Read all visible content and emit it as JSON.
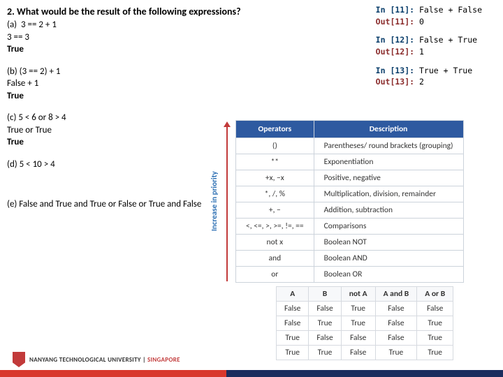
{
  "title": "2. What would be the result of the following expressions?",
  "qa": {
    "a_label": "(a)  3 == 2 + 1",
    "a_line2": "3 == 3",
    "a_ans": "True",
    "b_label": "(b) (3 == 2) + 1",
    "b_line2": "False + 1",
    "b_ans": "True",
    "c_label": "(c) 5 < 6 or 8 > 4",
    "c_line2": "True or True",
    "c_ans": "True",
    "d_label": "(d) 5 < 10 > 4",
    "e_label": "(e) False and True and True or False or True and False"
  },
  "code": {
    "in11": "In [11]:",
    "in11v": " False + False",
    "out11": "Out[11]:",
    "out11v": " 0",
    "in12": "In [12]:",
    "in12v": " False + True",
    "out12": "Out[12]:",
    "out12v": " 1",
    "in13": "In [13]:",
    "in13v": " True + True",
    "out13": "Out[13]:",
    "out13v": " 2"
  },
  "op_table": {
    "h1": "Operators",
    "h2": "Description",
    "rows": [
      {
        "op": "()",
        "desc": "Parentheses/ round brackets (grouping)"
      },
      {
        "op": "**",
        "desc": "Exponentiation"
      },
      {
        "op": "+x, −x",
        "desc": "Positive, negative"
      },
      {
        "op": "*, /, %",
        "desc": "Multiplication, division, remainder"
      },
      {
        "op": "+, −",
        "desc": "Addition, subtraction"
      },
      {
        "op": "<, <=, >, >=, !=, ==",
        "desc": "Comparisons"
      },
      {
        "op": "not x",
        "desc": "Boolean NOT"
      },
      {
        "op": "and",
        "desc": "Boolean AND"
      },
      {
        "op": "or",
        "desc": "Boolean OR"
      }
    ],
    "priority_label": "Increase in priority"
  },
  "truth": {
    "head": {
      "a": "A",
      "b": "B",
      "not": "not A",
      "and": "A and B",
      "or": "A or B"
    },
    "rows": [
      {
        "a": "False",
        "b": "False",
        "not": "True",
        "and": "False",
        "or": "False"
      },
      {
        "a": "False",
        "b": "True",
        "not": "True",
        "and": "False",
        "or": "True"
      },
      {
        "a": "True",
        "b": "False",
        "not": "False",
        "and": "False",
        "or": "True"
      },
      {
        "a": "True",
        "b": "True",
        "not": "False",
        "and": "True",
        "or": "True"
      }
    ]
  },
  "footer": {
    "uni": "NANYANG TECHNOLOGICAL UNIVERSITY",
    "sg": "SINGAPORE"
  }
}
